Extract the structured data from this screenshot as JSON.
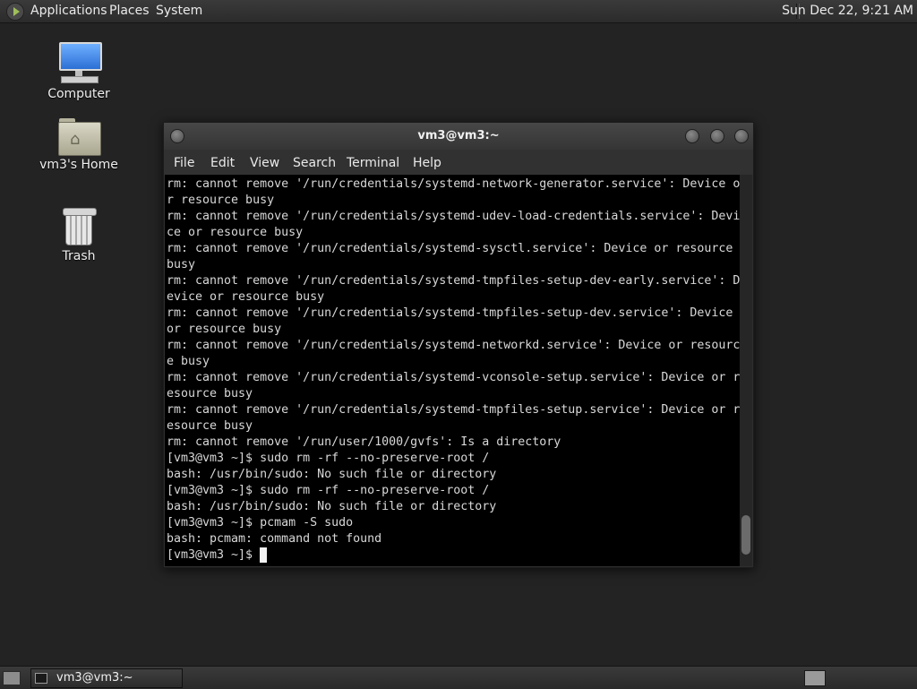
{
  "top_panel": {
    "menus": [
      "Applications",
      "Places",
      "System"
    ],
    "clock": "Sun Dec 22,  9:21 AM"
  },
  "desktop": {
    "icons": [
      {
        "label": "Computer",
        "icon": "computer-icon"
      },
      {
        "label": "vm3's Home",
        "icon": "home-folder-icon"
      },
      {
        "label": "Trash",
        "icon": "trash-icon"
      }
    ]
  },
  "terminal": {
    "title": "vm3@vm3:~",
    "menu": [
      "File",
      "Edit",
      "View",
      "Search",
      "Terminal",
      "Help"
    ],
    "lines": [
      "rm: cannot remove '/run/credentials/systemd-network-generator.service': Device o",
      "r resource busy",
      "rm: cannot remove '/run/credentials/systemd-udev-load-credentials.service': Devi",
      "ce or resource busy",
      "rm: cannot remove '/run/credentials/systemd-sysctl.service': Device or resource",
      "busy",
      "rm: cannot remove '/run/credentials/systemd-tmpfiles-setup-dev-early.service': D",
      "evice or resource busy",
      "rm: cannot remove '/run/credentials/systemd-tmpfiles-setup-dev.service': Device",
      "or resource busy",
      "rm: cannot remove '/run/credentials/systemd-networkd.service': Device or resourc",
      "e busy",
      "rm: cannot remove '/run/credentials/systemd-vconsole-setup.service': Device or r",
      "esource busy",
      "rm: cannot remove '/run/credentials/systemd-tmpfiles-setup.service': Device or r",
      "esource busy",
      "rm: cannot remove '/run/user/1000/gvfs': Is a directory",
      "[vm3@vm3 ~]$ sudo rm -rf --no-preserve-root /",
      "bash: /usr/bin/sudo: No such file or directory",
      "[vm3@vm3 ~]$ sudo rm -rf --no-preserve-root /",
      "bash: /usr/bin/sudo: No such file or directory",
      "[vm3@vm3 ~]$ pcmam -S sudo",
      "bash: pcmam: command not found",
      "[vm3@vm3 ~]$ "
    ]
  },
  "bottom_panel": {
    "task_label": "vm3@vm3:~"
  }
}
